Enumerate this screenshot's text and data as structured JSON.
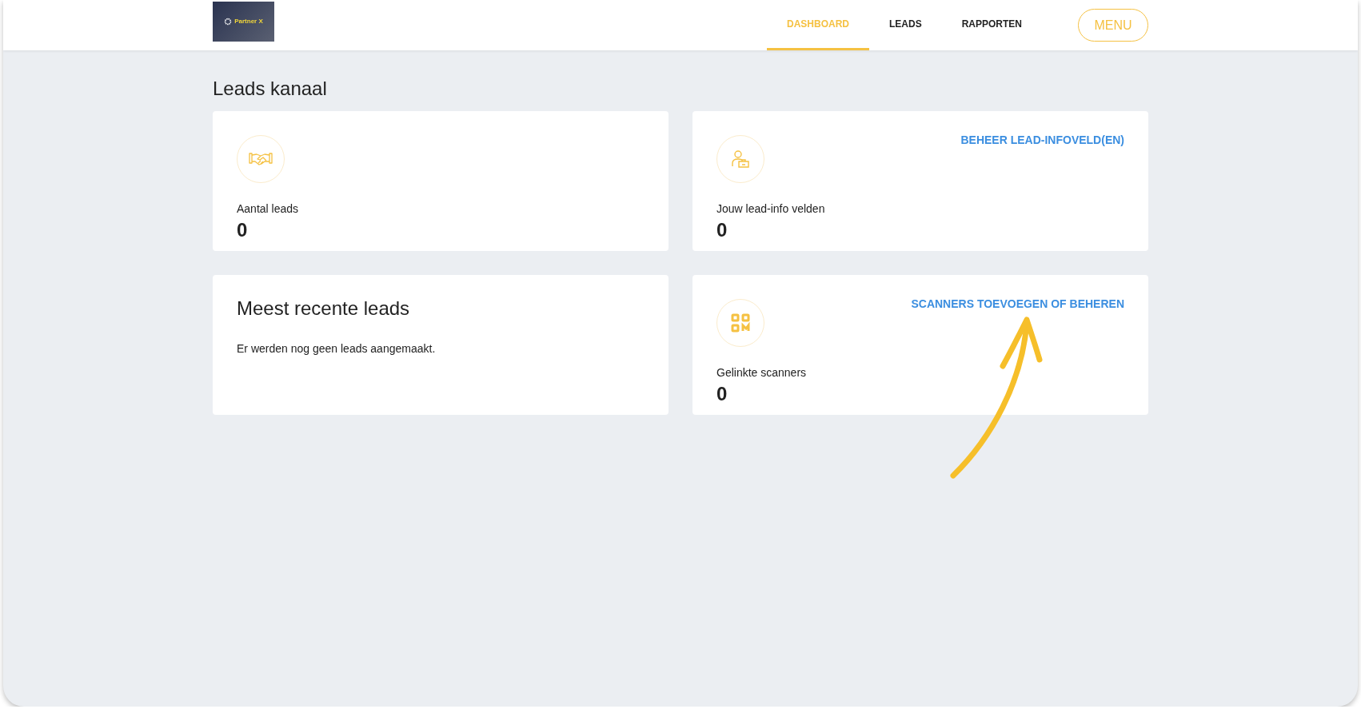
{
  "logo": {
    "text": "Partner X"
  },
  "nav": [
    {
      "label": "DASHBOARD",
      "selected": true
    },
    {
      "label": "LEADS",
      "selected": false
    },
    {
      "label": "RAPPORTEN",
      "selected": false
    }
  ],
  "menu_button": "MENU",
  "page_title": "Leads kanaal",
  "cards": [
    {
      "kind": "stat",
      "label": "Aantal leads",
      "value": "0"
    },
    {
      "kind": "recent",
      "title": "Meest recente leads",
      "message": "Er werden nog geen leads aangemaakt."
    },
    {
      "kind": "stat",
      "link": "BEHEER LEAD-INFOVELD(EN)",
      "label": "Jouw lead-info velden",
      "value": "0"
    },
    {
      "kind": "stat",
      "link": "SCANNERS TOEVOEGEN OF BEHEREN",
      "label": "Gelinkte scanners",
      "value": "0"
    }
  ]
}
